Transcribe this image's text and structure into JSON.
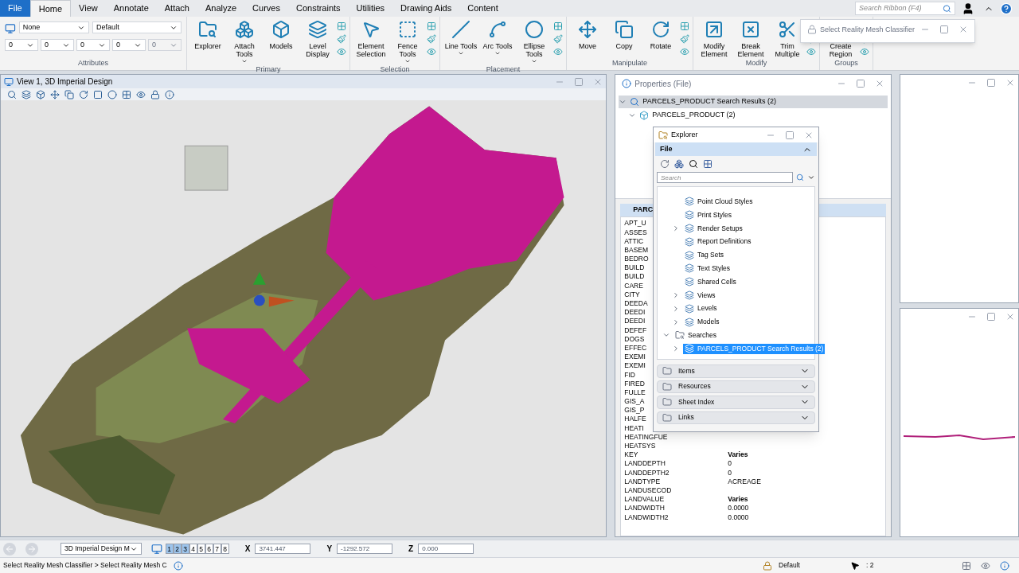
{
  "ribbon": {
    "tabs": [
      {
        "label": "File",
        "selected": false,
        "kind": "file"
      },
      {
        "label": "Home",
        "selected": true,
        "kind": "tab"
      },
      {
        "label": "View",
        "selected": false,
        "kind": "tab"
      },
      {
        "label": "Annotate",
        "selected": false,
        "kind": "tab"
      },
      {
        "label": "Attach",
        "selected": false,
        "kind": "tab"
      },
      {
        "label": "Analyze",
        "selected": false,
        "kind": "tab"
      },
      {
        "label": "Curves",
        "selected": false,
        "kind": "tab"
      },
      {
        "label": "Constraints",
        "selected": false,
        "kind": "tab"
      },
      {
        "label": "Utilities",
        "selected": false,
        "kind": "tab"
      },
      {
        "label": "Drawing Aids",
        "selected": false,
        "kind": "tab"
      },
      {
        "label": "Content",
        "selected": false,
        "kind": "tab"
      }
    ],
    "search": {
      "placeholder": "Search Ribbon (F4)"
    },
    "attributes": {
      "label": "Attributes",
      "level": "None",
      "style": "Default",
      "fields": [
        {
          "value": "0",
          "disabled": false
        },
        {
          "value": "0",
          "disabled": false
        },
        {
          "value": "0",
          "disabled": false
        },
        {
          "value": "0",
          "disabled": false
        },
        {
          "value": "0",
          "disabled": true
        }
      ]
    },
    "groups": [
      {
        "label": "Primary",
        "buttons": [
          {
            "label": "Explorer",
            "kind": "explorer",
            "has_menu": false
          },
          {
            "label": "Attach Tools",
            "kind": "attach",
            "has_menu": true
          },
          {
            "label": "Models",
            "kind": "models",
            "has_menu": false
          },
          {
            "label": "Level Display",
            "kind": "levels",
            "has_menu": false
          }
        ]
      },
      {
        "label": "Selection",
        "buttons": [
          {
            "label": "Element Selection",
            "kind": "select",
            "has_menu": false
          },
          {
            "label": "Fence Tools",
            "kind": "fence",
            "has_menu": true
          }
        ]
      },
      {
        "label": "Placement",
        "buttons": [
          {
            "label": "Line Tools",
            "kind": "line",
            "has_menu": true
          },
          {
            "label": "Arc Tools",
            "kind": "arc",
            "has_menu": true
          },
          {
            "label": "Ellipse Tools",
            "kind": "ellipse",
            "has_menu": true
          }
        ]
      },
      {
        "label": "Manipulate",
        "buttons": [
          {
            "label": "Move",
            "kind": "move",
            "has_menu": false
          },
          {
            "label": "Copy",
            "kind": "copy",
            "has_menu": false
          },
          {
            "label": "Rotate",
            "kind": "rotate",
            "has_menu": false
          }
        ]
      },
      {
        "label": "Modify",
        "buttons": [
          {
            "label": "Modify Element",
            "kind": "modify",
            "has_menu": false
          },
          {
            "label": "Break Element",
            "kind": "break",
            "has_menu": false
          },
          {
            "label": "Trim Multiple",
            "kind": "trim",
            "has_menu": false
          }
        ]
      },
      {
        "label": "Groups",
        "buttons": [
          {
            "label": "Create Region",
            "kind": "region",
            "has_menu": false
          }
        ]
      }
    ]
  },
  "classifier_dialog": {
    "title": "Select Reality Mesh Classifier"
  },
  "view": {
    "title": "View 1, 3D Imperial Design"
  },
  "properties": {
    "title": "Properties (File)",
    "tree": [
      {
        "label": "PARCELS_PRODUCT Search Results (2)",
        "selected": true,
        "expanded": true,
        "children": [
          {
            "label": "PARCELS_PRODUCT (2)",
            "selected": false,
            "expanded": true
          }
        ]
      }
    ],
    "section": "PARC",
    "rows": [
      {
        "name": "APT_U"
      },
      {
        "name": "ASSES"
      },
      {
        "name": "ATTIC"
      },
      {
        "name": "BASEM"
      },
      {
        "name": "BEDRO"
      },
      {
        "name": "BUILD"
      },
      {
        "name": "BUILD"
      },
      {
        "name": "CARE"
      },
      {
        "name": "CITY"
      },
      {
        "name": "DEEDA"
      },
      {
        "name": "DEEDI"
      },
      {
        "name": "DEEDI"
      },
      {
        "name": "DEFEF"
      },
      {
        "name": "DOGS"
      },
      {
        "name": "EFFEC"
      },
      {
        "name": "EXEMI"
      },
      {
        "name": "EXEMI"
      },
      {
        "name": "FID"
      },
      {
        "name": "FIRED"
      },
      {
        "name": "FULLE"
      },
      {
        "name": "GIS_A"
      },
      {
        "name": "GIS_P"
      },
      {
        "name": "HALFE"
      },
      {
        "name": "HEATI"
      },
      {
        "name": "HEATINGFUE"
      },
      {
        "name": "HEATSYS"
      },
      {
        "name": "KEY",
        "value": "**Varies**"
      },
      {
        "name": "LANDDEPTH",
        "value": "0"
      },
      {
        "name": "LANDDEPTH2",
        "value": "0"
      },
      {
        "name": "LANDTYPE",
        "value": "ACREAGE"
      },
      {
        "name": "LANDUSECOD"
      },
      {
        "name": "LANDVALUE",
        "value": "**Varies**"
      },
      {
        "name": "LANDWIDTH",
        "value": "0.0000"
      },
      {
        "name": "LANDWIDTH2",
        "value": "0.0000"
      }
    ]
  },
  "explorer": {
    "title": "Explorer",
    "file_section": {
      "label": "File",
      "expanded": true
    },
    "search": {
      "placeholder": "Search"
    },
    "tree": [
      {
        "label": "Point Cloud Styles",
        "kind": "leaf",
        "selected": false
      },
      {
        "label": "Print Styles",
        "kind": "leaf",
        "selected": false
      },
      {
        "label": "Render Setups",
        "kind": "node",
        "expanded": false,
        "selected": false
      },
      {
        "label": "Report Definitions",
        "kind": "leaf",
        "selected": false
      },
      {
        "label": "Tag Sets",
        "kind": "leaf",
        "selected": false
      },
      {
        "label": "Text Styles",
        "kind": "leaf",
        "selected": false
      },
      {
        "label": "Shared Cells",
        "kind": "leaf",
        "selected": false
      },
      {
        "label": "Views",
        "kind": "node",
        "expanded": false,
        "selected": false
      },
      {
        "label": "Levels",
        "kind": "node",
        "expanded": false,
        "selected": false
      },
      {
        "label": "Models",
        "kind": "node",
        "expanded": false,
        "selected": false
      },
      {
        "label": "Searches",
        "kind": "root",
        "expanded": true,
        "selected": false,
        "children": [
          {
            "label": "PARCELS_PRODUCT Search Results (2)",
            "kind": "node",
            "expanded": false,
            "selected": true
          }
        ]
      }
    ],
    "sections": [
      {
        "label": "Items",
        "expanded": false
      },
      {
        "label": "Resources",
        "expanded": false
      },
      {
        "label": "Sheet Index",
        "expanded": false
      },
      {
        "label": "Links",
        "expanded": false
      }
    ]
  },
  "view_bar": {
    "model": "3D Imperial Design M",
    "views": [
      {
        "label": "1",
        "selected": true
      },
      {
        "label": "2",
        "selected": true
      },
      {
        "label": "3",
        "selected": true
      },
      {
        "label": "4",
        "selected": false
      },
      {
        "label": "5",
        "selected": false
      },
      {
        "label": "6",
        "selected": false
      },
      {
        "label": "7",
        "selected": false
      },
      {
        "label": "8",
        "selected": false
      }
    ],
    "coords": [
      {
        "axis": "X",
        "value": "3741.447"
      },
      {
        "axis": "Y",
        "value": "-1292.572"
      },
      {
        "axis": "Z",
        "value": "0.000"
      }
    ]
  },
  "status_bar": {
    "prompt": "Select Reality Mesh Classifier > Select Reality Mesh C",
    "level": "Default",
    "count": ": 2"
  }
}
